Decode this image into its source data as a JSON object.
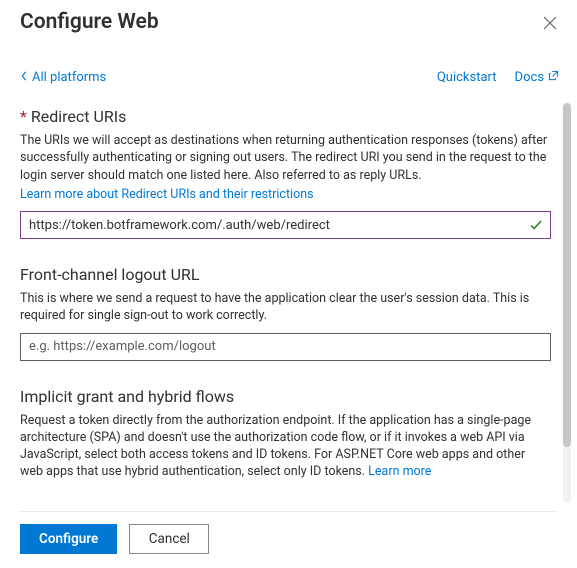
{
  "header": {
    "title": "Configure Web"
  },
  "topbar": {
    "back_label": "All platforms",
    "quickstart_label": "Quickstart",
    "docs_label": "Docs"
  },
  "sections": {
    "redirect": {
      "heading": "Redirect URIs",
      "desc": "The URIs we will accept as destinations when returning authentication responses (tokens) after successfully authenticating or signing out users. The redirect URI you send in the request to the login server should match one listed here. Also referred to as reply URLs.",
      "learn_more": "Learn more about Redirect URIs and their restrictions",
      "value": "https://token.botframework.com/.auth/web/redirect"
    },
    "logout": {
      "heading": "Front-channel logout URL",
      "desc": "This is where we send a request to have the application clear the user's session data. This is required for single sign-out to work correctly.",
      "placeholder": "e.g. https://example.com/logout",
      "value": ""
    },
    "implicit": {
      "heading": "Implicit grant and hybrid flows",
      "desc": "Request a token directly from the authorization endpoint. If the application has a single-page architecture (SPA) and doesn't use the authorization code flow, or if it invokes a web API via JavaScript, select both access tokens and ID tokens. For ASP.NET Core web apps and other web apps that use hybrid authentication, select only ID tokens. ",
      "learn_more": "Learn more"
    }
  },
  "footer": {
    "configure_label": "Configure",
    "cancel_label": "Cancel"
  }
}
